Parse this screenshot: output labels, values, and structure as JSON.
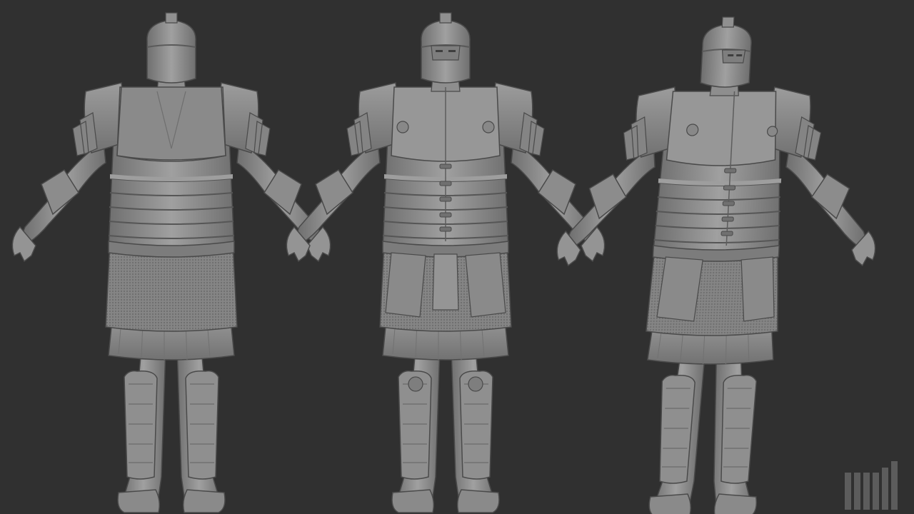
{
  "scene": {
    "views": [
      {
        "id": "back",
        "label": ""
      },
      {
        "id": "front",
        "label": ""
      },
      {
        "id": "three-quarter",
        "label": ""
      }
    ],
    "logo": {
      "icon": "zbrush-bars-logo"
    }
  },
  "colors": {
    "background": "#303030",
    "clay": "#8d8d8d",
    "clay_light": "#a3a3a3",
    "clay_dark": "#6a6a6a",
    "outline": "#4a4a4a",
    "logo": "#5c5c5c"
  }
}
